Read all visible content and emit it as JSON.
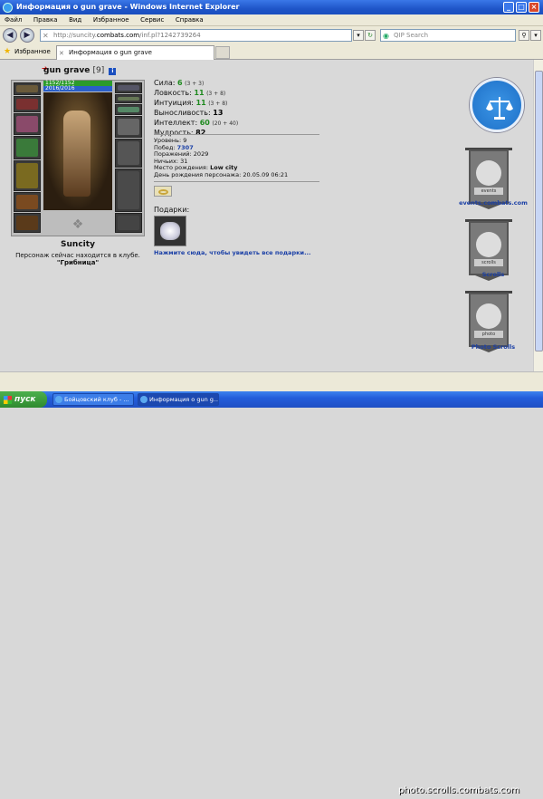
{
  "window": {
    "title": "Информация о gun grave - Windows Internet Explorer",
    "minimize": "_",
    "maximize": "□",
    "close": "×"
  },
  "menu": [
    "Файл",
    "Правка",
    "Вид",
    "Избранное",
    "Сервис",
    "Справка"
  ],
  "address": {
    "prefix": "http://suncity.",
    "domain": "combats.com",
    "suffix": "/inf.pl?1242739264",
    "search_placeholder": "QIP Search"
  },
  "tabs": {
    "favorites": "Избранное",
    "active": "Информация о gun grave"
  },
  "character": {
    "name": "gun grave",
    "level": "[9]",
    "hp": "1152/1152",
    "mana": "2016/2016",
    "city": "Suncity",
    "location_text": "Персонаж сейчас находится в клубе.",
    "club": "\"Грибница\""
  },
  "stats": [
    {
      "label": "Сила:",
      "value": "6",
      "extra": "(3 + 3)",
      "color": "green"
    },
    {
      "label": "Ловкость:",
      "value": "11",
      "extra": "(3 + 8)",
      "color": "green"
    },
    {
      "label": "Интуиция:",
      "value": "11",
      "extra": "(3 + 8)",
      "color": "green"
    },
    {
      "label": "Выносливость:",
      "value": "13",
      "extra": "",
      "color": "black"
    },
    {
      "label": "Интеллект:",
      "value": "60",
      "extra": "(20 + 40)",
      "color": "green"
    },
    {
      "label": "Мудрость:",
      "value": "82",
      "extra": "",
      "color": "black"
    }
  ],
  "info": {
    "level_label": "Уровень:",
    "level_value": "9",
    "wins_label": "Побед:",
    "wins_value": "7307",
    "losses_label": "Поражений:",
    "losses_value": "2029",
    "draws_label": "Ничьих:",
    "draws_value": "31",
    "birthplace_label": "Место рождения:",
    "birthplace_value": "Low city",
    "birthday_label": "День рождения персонажа:",
    "birthday_value": "20.05.09 06:21"
  },
  "gifts": {
    "label": "Подарки:",
    "link": "Нажмите сюда, чтобы увидеть все подарки..."
  },
  "sidebar": {
    "events_label": "events.combats.com",
    "events_caption": "events",
    "scrolls_label": "Scrolls",
    "scrolls_caption": "scrolls",
    "photo_label": "Photo Scrolls",
    "photo_caption": "photo"
  },
  "taskbar": {
    "start": "пуск",
    "task1": "Бойцовский клуб - ...",
    "task2": "Информация о gun g...",
    "watermark": "photo.scrolls.combats.com"
  }
}
